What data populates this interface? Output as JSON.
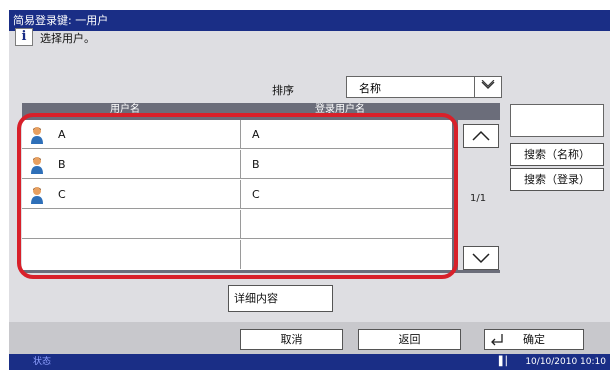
{
  "title": "简易登录键:  一用户",
  "message": "选择用户。",
  "sort": {
    "label": "排序",
    "value": "名称"
  },
  "columns": [
    "用户名",
    "登录用户名"
  ],
  "rows": [
    {
      "name": "A",
      "login": "A",
      "icon": "user-icon"
    },
    {
      "name": "B",
      "login": "B",
      "icon": "user-icon"
    },
    {
      "name": "C",
      "login": "C",
      "icon": "user-icon"
    },
    {
      "name": "",
      "login": ""
    },
    {
      "name": "",
      "login": ""
    }
  ],
  "page_indicator": "1/1",
  "buttons": {
    "search_name": "搜索（名称）",
    "search_login": "搜索（登录）",
    "details": "详细内容",
    "cancel": "取消",
    "back": "返回",
    "ok": "确定"
  },
  "status": {
    "tab": "状态",
    "datetime": "10/10/2010  10:10"
  },
  "colors": {
    "title_bar": "#1a2e86",
    "highlight": "#d8202a",
    "panel": "#dedee2",
    "table_header": "#6b6d7a"
  }
}
